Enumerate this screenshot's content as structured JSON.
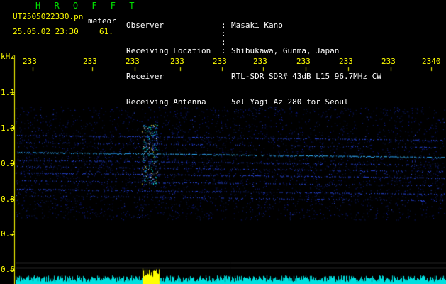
{
  "header": {
    "title": "H R O F F T",
    "filename": "UT2505022330.pn",
    "tag": "meteor",
    "datetime": "25.05.02 23:30",
    "count": "61.",
    "fields": [
      {
        "label": "Observer",
        "value": "Masaki Kano"
      },
      {
        "label": "Receiving Location",
        "value": "Shibukawa, Gunma, Japan"
      },
      {
        "label": "Receiver",
        "value": "RTL-SDR SDR# 43dB L15 96.7MHz CW"
      },
      {
        "label": "Receiving Antenna",
        "value": "5el Yagi Az 280 for Seoul"
      }
    ]
  },
  "axis": {
    "unit": "kHz",
    "time_ticks": [
      "233",
      "233",
      "233",
      "233",
      "233",
      "233",
      "233",
      "233",
      "233",
      "2340"
    ],
    "freq_ticks": [
      "1.1",
      "1.0",
      "0.9",
      "0.8",
      "0.7",
      "0.6"
    ]
  },
  "colors": {
    "axis": "#ffff00",
    "text": "#ffffff",
    "title": "#00e000",
    "signal": "#3060ff",
    "meteor": "#00ffff",
    "histogram": "#00e0e0",
    "histogram_peak": "#ffff00"
  }
}
